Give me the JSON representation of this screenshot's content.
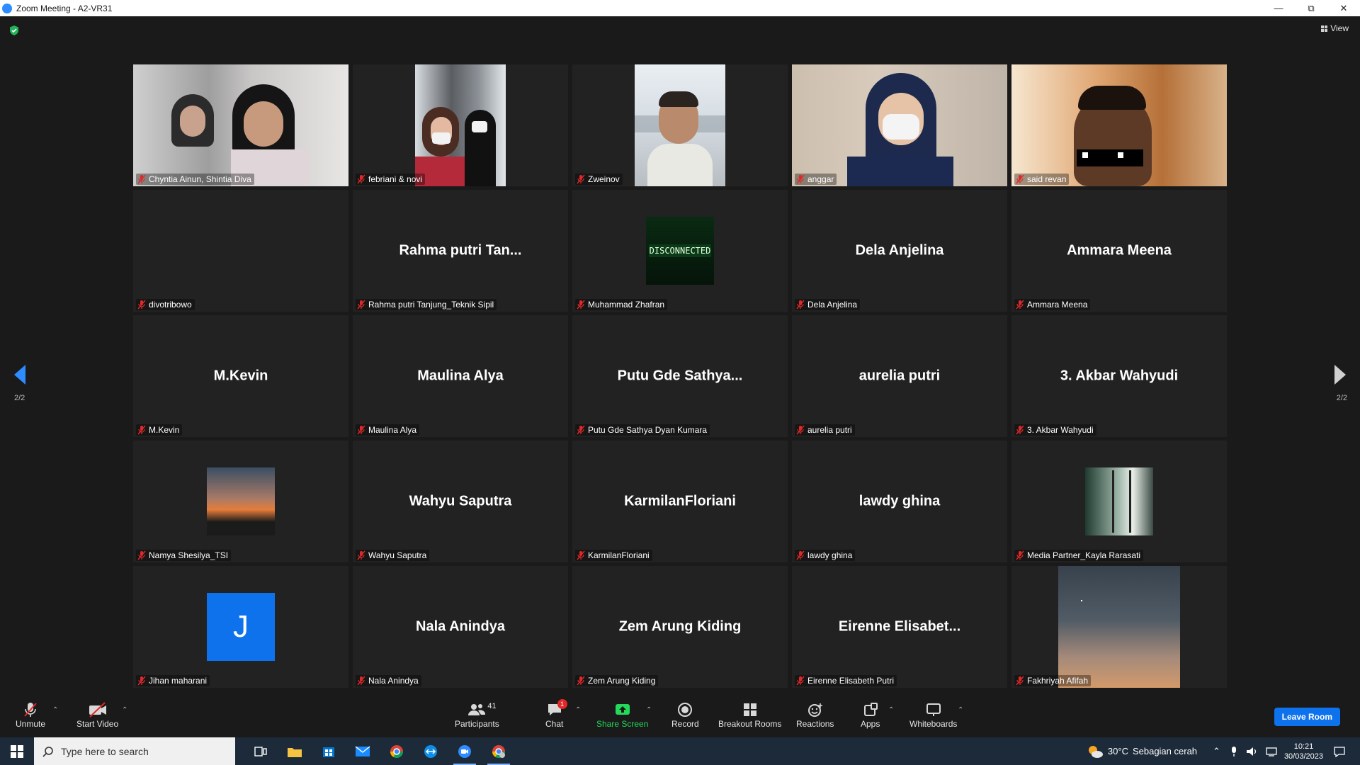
{
  "window": {
    "title": "Zoom Meeting - A2-VR31"
  },
  "view_label": "View",
  "pager": {
    "left": "2/2",
    "right": "2/2"
  },
  "tiles": [
    {
      "bigname": "",
      "label": "Chyntia Ainun, Shintia Diva",
      "video": "gray-room"
    },
    {
      "bigname": "",
      "label": "febriani & novi",
      "video": "window-pair"
    },
    {
      "bigname": "",
      "label": "Zweinov",
      "video": "outdoor-portrait"
    },
    {
      "bigname": "",
      "label": "anggar",
      "video": "hijab-mask"
    },
    {
      "bigname": "",
      "label": "said revan",
      "video": "warm-room"
    },
    {
      "bigname": "",
      "label": "divotribowo",
      "video": ""
    },
    {
      "bigname": "Rahma putri Tan...",
      "label": "Rahma putri Tanjung_Teknik Sipil",
      "video": ""
    },
    {
      "bigname": "",
      "label": "Muhammad Zhafran",
      "video": "disconnected",
      "avatar_text": "DISCONNECTED"
    },
    {
      "bigname": "Dela Anjelina",
      "label": "Dela Anjelina",
      "video": ""
    },
    {
      "bigname": "Ammara Meena",
      "label": "Ammara Meena",
      "video": ""
    },
    {
      "bigname": "M.Kevin",
      "label": "M.Kevin",
      "video": ""
    },
    {
      "bigname": "Maulina Alya",
      "label": "Maulina Alya",
      "video": ""
    },
    {
      "bigname": "Putu Gde Sathya...",
      "label": "Putu Gde Sathya Dyan Kumara",
      "video": ""
    },
    {
      "bigname": "aurelia putri",
      "label": "aurelia putri",
      "video": ""
    },
    {
      "bigname": "3. Akbar Wahyudi",
      "label": "3. Akbar Wahyudi",
      "video": ""
    },
    {
      "bigname": "",
      "label": "Namya Shesilya_TSI",
      "video": "sunset-avatar"
    },
    {
      "bigname": "Wahyu Saputra",
      "label": "Wahyu Saputra",
      "video": ""
    },
    {
      "bigname": "KarmilanFloriani",
      "label": "KarmilanFloriani",
      "video": ""
    },
    {
      "bigname": "lawdy ghina",
      "label": "lawdy ghina",
      "video": ""
    },
    {
      "bigname": "",
      "label": "Media Partner_Kayla Rarasati",
      "video": "window-avatar"
    },
    {
      "bigname": "",
      "label": "Jihan maharani",
      "video": "letter-avatar",
      "avatar_text": "J"
    },
    {
      "bigname": "Nala Anindya",
      "label": "Nala Anindya",
      "video": ""
    },
    {
      "bigname": "Zem Arung Kiding",
      "label": "Zem Arung Kiding",
      "video": ""
    },
    {
      "bigname": "Eirenne Elisabet...",
      "label": "Eirenne Elisabeth Putri",
      "video": ""
    },
    {
      "bigname": "",
      "label": "Fakhriyah Afifah",
      "video": "dusk-sky"
    }
  ],
  "toolbar": {
    "unmute": "Unmute",
    "start_video": "Start Video",
    "participants": "Participants",
    "participants_count": "41",
    "chat": "Chat",
    "chat_badge": "1",
    "share_screen": "Share Screen",
    "record": "Record",
    "breakout_rooms": "Breakout Rooms",
    "reactions": "Reactions",
    "apps": "Apps",
    "whiteboards": "Whiteboards",
    "leave_room": "Leave Room"
  },
  "taskbar": {
    "search_placeholder": "Type here to search",
    "weather_temp": "30°C",
    "weather_desc": "Sebagian cerah",
    "time": "10:21",
    "date": "30/03/2023",
    "icons": [
      "task-view-icon",
      "file-explorer-icon",
      "store-icon",
      "mail-icon",
      "chrome-icon",
      "teamviewer-icon",
      "zoom-icon",
      "chrome-profile-icon"
    ]
  },
  "colors": {
    "accent": "#2d8cff",
    "leave": "#0e72ed",
    "share_green": "#23d959",
    "muted_red": "#e02828"
  }
}
